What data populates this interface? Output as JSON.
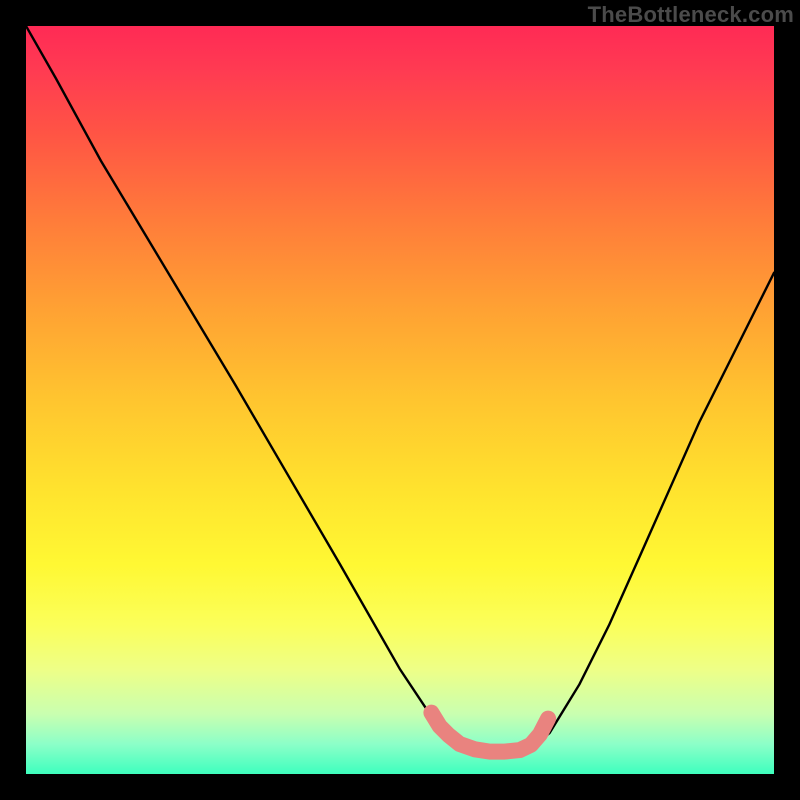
{
  "watermark": {
    "text": "TheBottleneck.com"
  },
  "chart_data": {
    "type": "line",
    "title": "",
    "xlabel": "",
    "ylabel": "",
    "xlim": [
      0,
      100
    ],
    "ylim": [
      0,
      100
    ],
    "grid": false,
    "series": [
      {
        "name": "bottleneck-curve",
        "color": "#000000",
        "x": [
          0,
          4,
          10,
          16,
          22,
          28,
          35,
          42,
          50,
          54,
          56,
          58,
          60,
          62,
          64,
          66,
          68,
          70,
          74,
          78,
          82,
          86,
          90,
          94,
          100
        ],
        "y": [
          100,
          93,
          82,
          72,
          62,
          52,
          40,
          28,
          14,
          8,
          5,
          3.7,
          3.2,
          3.0,
          3.0,
          3.2,
          3.8,
          5.5,
          12,
          20,
          29,
          38,
          47,
          55,
          67
        ]
      }
    ],
    "marker": {
      "name": "optimal-region",
      "color": "#e9837f",
      "x": [
        54.2,
        55.3,
        56.5,
        58,
        60,
        62,
        64,
        66,
        67.5,
        68.7,
        69.8
      ],
      "y": [
        8.2,
        6.4,
        5.2,
        4.0,
        3.3,
        3.0,
        3.0,
        3.2,
        3.9,
        5.3,
        7.4
      ]
    }
  }
}
